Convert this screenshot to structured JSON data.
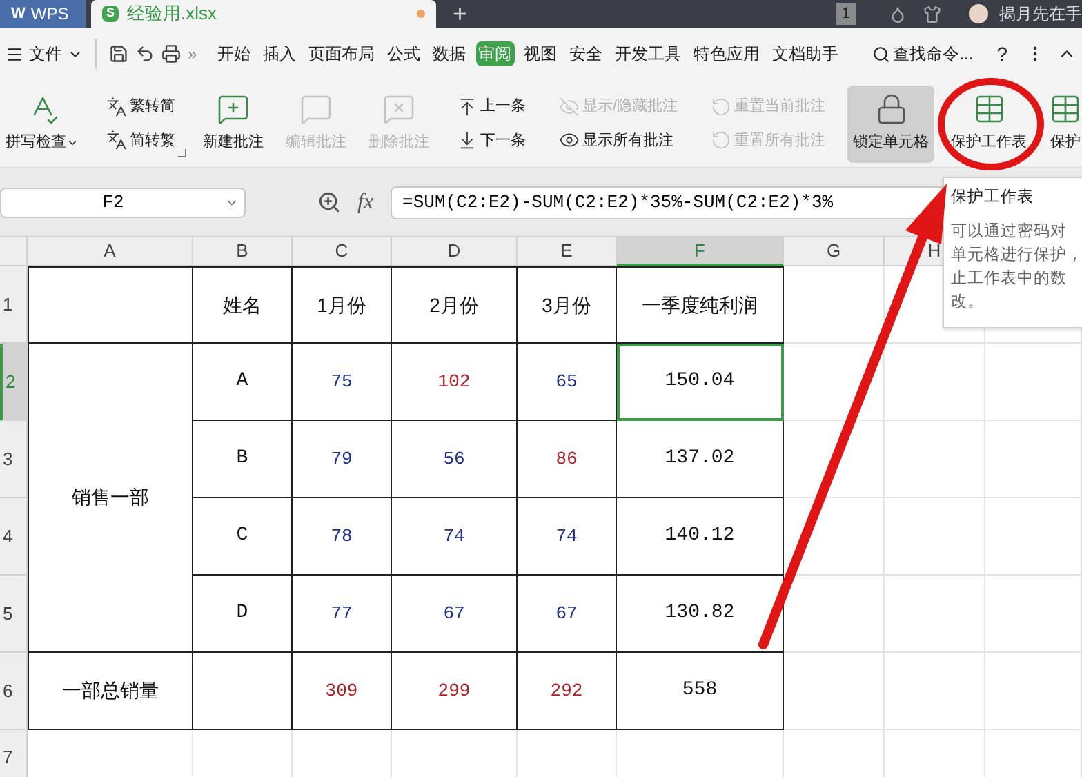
{
  "title_bar": {
    "app_tab": {
      "logo": "W",
      "label": "WPS"
    },
    "file_tab": {
      "icon_letter": "S",
      "label": "经验用.xlsx",
      "modified": true
    },
    "new_tab": "+",
    "window_count": "1",
    "user_name": "揭月先在手"
  },
  "menu_bar": {
    "file_menu": "文件",
    "overflow": "»",
    "tabs": [
      {
        "label": "开始",
        "selected": false
      },
      {
        "label": "插入",
        "selected": false
      },
      {
        "label": "页面布局",
        "selected": false
      },
      {
        "label": "公式",
        "selected": false
      },
      {
        "label": "数据",
        "selected": false
      },
      {
        "label": "审阅",
        "selected": true
      },
      {
        "label": "视图",
        "selected": false
      },
      {
        "label": "安全",
        "selected": false
      },
      {
        "label": "开发工具",
        "selected": false
      },
      {
        "label": "特色应用",
        "selected": false
      },
      {
        "label": "文档助手",
        "selected": false
      }
    ],
    "search": "查找命令...",
    "help": "?"
  },
  "ribbon": {
    "groups": [
      [
        {
          "kind": "large",
          "label": "拼写检查",
          "dropdown": true,
          "disabled": false,
          "on": false
        }
      ],
      [
        {
          "kind": "stack",
          "launcher": true,
          "items": [
            {
              "label": "繁转简",
              "disabled": false
            },
            {
              "label": "简转繁",
              "disabled": false
            }
          ]
        }
      ],
      [
        {
          "kind": "large",
          "label": "新建批注",
          "disabled": false,
          "on": false
        },
        {
          "kind": "large",
          "label": "编辑批注",
          "disabled": true,
          "on": false
        },
        {
          "kind": "large",
          "label": "删除批注",
          "disabled": true,
          "on": false
        },
        {
          "kind": "stack",
          "items": [
            {
              "label": "上一条",
              "disabled": false
            },
            {
              "label": "下一条",
              "disabled": false
            }
          ]
        },
        {
          "kind": "stack",
          "items": [
            {
              "label": "显示/隐藏批注",
              "disabled": true
            },
            {
              "label": "显示所有批注",
              "disabled": false
            }
          ]
        },
        {
          "kind": "stack",
          "items": [
            {
              "label": "重置当前批注",
              "disabled": true
            },
            {
              "label": "重置所有批注",
              "disabled": true
            }
          ]
        }
      ],
      [
        {
          "kind": "large",
          "label": "锁定单元格",
          "disabled": false,
          "on": true
        },
        {
          "kind": "large",
          "label": "保护工作表",
          "disabled": false,
          "on": false
        },
        {
          "kind": "large",
          "label": "保护",
          "disabled": false,
          "on": false
        }
      ]
    ]
  },
  "formula_bar": {
    "cell_name": "F2",
    "fx": "fx",
    "formula": "=SUM(C2:E2)-SUM(C2:E2)*35%-SUM(C2:E2)*3%"
  },
  "sheet": {
    "columns": [
      {
        "label": "A",
        "selected": false
      },
      {
        "label": "B",
        "selected": false
      },
      {
        "label": "C",
        "selected": false
      },
      {
        "label": "D",
        "selected": false
      },
      {
        "label": "E",
        "selected": false
      },
      {
        "label": "F",
        "selected": true
      },
      {
        "label": "G",
        "selected": false
      },
      {
        "label": "H",
        "selected": false
      }
    ],
    "row_headers": [
      {
        "label": "1",
        "selected": false
      },
      {
        "label": "2",
        "selected": true
      },
      {
        "label": "3",
        "selected": false
      },
      {
        "label": "4",
        "selected": false
      },
      {
        "label": "5",
        "selected": false
      },
      {
        "label": "6",
        "selected": false
      },
      {
        "label": "7",
        "selected": false
      }
    ],
    "header_cells": [
      "姓名",
      "1月份",
      "2月份",
      "3月份",
      "一季度纯利润"
    ],
    "group": {
      "label": "销售一部",
      "rows": [
        {
          "name": "A",
          "values": [
            {
              "text": "75",
              "color": "#1f2f8f"
            },
            {
              "text": "102",
              "color": "#b0202a"
            },
            {
              "text": "65",
              "color": "#1f2f8f"
            }
          ],
          "total": "150.04",
          "selected": true
        },
        {
          "name": "B",
          "values": [
            {
              "text": "79",
              "color": "#1f2f8f"
            },
            {
              "text": "56",
              "color": "#1f2f8f"
            },
            {
              "text": "86",
              "color": "#b0202a"
            }
          ],
          "total": "137.02",
          "selected": false
        },
        {
          "name": "C",
          "values": [
            {
              "text": "78",
              "color": "#1f2f8f"
            },
            {
              "text": "74",
              "color": "#1f2f8f"
            },
            {
              "text": "74",
              "color": "#1f2f8f"
            }
          ],
          "total": "140.12",
          "selected": false
        },
        {
          "name": "D",
          "values": [
            {
              "text": "77",
              "color": "#1f2f8f"
            },
            {
              "text": "67",
              "color": "#1f2f8f"
            },
            {
              "text": "67",
              "color": "#1f2f8f"
            }
          ],
          "total": "130.82",
          "selected": false
        }
      ]
    },
    "summary": {
      "label": "一部总销量",
      "values": [
        {
          "text": "309",
          "color": "#b0202a"
        },
        {
          "text": "299",
          "color": "#b0202a"
        },
        {
          "text": "292",
          "color": "#b0202a"
        }
      ],
      "total": "558"
    }
  },
  "tooltip": {
    "title": "保护工作表",
    "lines": [
      "可以通过密码对",
      "单元格进行保护，",
      "止工作表中的数",
      "改。"
    ]
  }
}
